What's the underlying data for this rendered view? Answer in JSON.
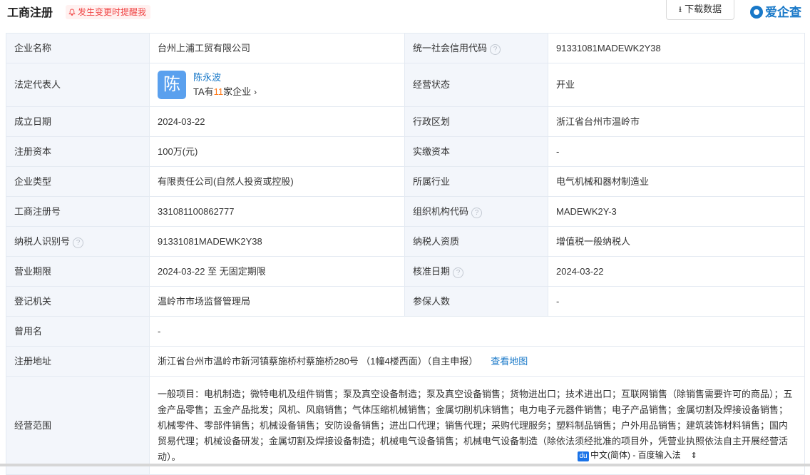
{
  "header": {
    "title": "工商注册",
    "remind": "发生变更时提醒我",
    "download": "下载数据",
    "brand": "爱企查"
  },
  "rows": {
    "r1": {
      "l1": "企业名称",
      "v1": "台州上浦工贸有限公司",
      "l2": "统一社会信用代码",
      "v2": "91331081MADEWK2Y38"
    },
    "r2": {
      "l1": "法定代表人",
      "avatar": "陈",
      "name": "陈永波",
      "ta_prefix": "TA有",
      "ta_count": "11",
      "ta_suffix": "家企业",
      "l2": "经营状态",
      "v2": "开业"
    },
    "r3": {
      "l1": "成立日期",
      "v1": "2024-03-22",
      "l2": "行政区划",
      "v2": "浙江省台州市温岭市"
    },
    "r4": {
      "l1": "注册资本",
      "v1": "100万(元)",
      "l2": "实缴资本",
      "v2": "-"
    },
    "r5": {
      "l1": "企业类型",
      "v1": "有限责任公司(自然人投资或控股)",
      "l2": "所属行业",
      "v2": "电气机械和器材制造业"
    },
    "r6": {
      "l1": "工商注册号",
      "v1": "331081100862777",
      "l2": "组织机构代码",
      "v2": "MADEWK2Y-3"
    },
    "r7": {
      "l1": "纳税人识别号",
      "v1": "91331081MADEWK2Y38",
      "l2": "纳税人资质",
      "v2": "增值税一般纳税人"
    },
    "r8": {
      "l1": "营业期限",
      "v1": "2024-03-22 至 无固定期限",
      "l2": "核准日期",
      "v2": "2024-03-22"
    },
    "r9": {
      "l1": "登记机关",
      "v1": "温岭市市场监督管理局",
      "l2": "参保人数",
      "v2": "-"
    },
    "r10": {
      "l1": "曾用名",
      "v1": "-"
    },
    "r11": {
      "l1": "注册地址",
      "v1": "浙江省台州市温岭市新河镇蔡施桥村蔡施桥280号 （1幢4楼西面）（自主申报）",
      "map": "查看地图"
    },
    "r12": {
      "l1": "经营范围",
      "v1": "一般项目：电机制造；微特电机及组件销售；泵及真空设备制造；泵及真空设备销售；货物进出口；技术进出口；互联网销售（除销售需要许可的商品）；五金产品零售；五金产品批发；风机、风扇销售；气体压缩机械销售；金属切削机床销售；电力电子元器件销售；电子产品销售；金属切割及焊接设备销售；机械零件、零部件销售；机械设备销售；安防设备销售；进出口代理；销售代理；采购代理服务；塑料制品销售；户外用品销售；建筑装饰材料销售；国内贸易代理；机械设备研发；金属切割及焊接设备制造；机械电气设备销售；机械电气设备制造（除依法须经批准的项目外，凭营业执照依法自主开展经营活动）。"
    }
  },
  "ime": {
    "logo": "du",
    "text": "中文(简体) - 百度输入法"
  }
}
